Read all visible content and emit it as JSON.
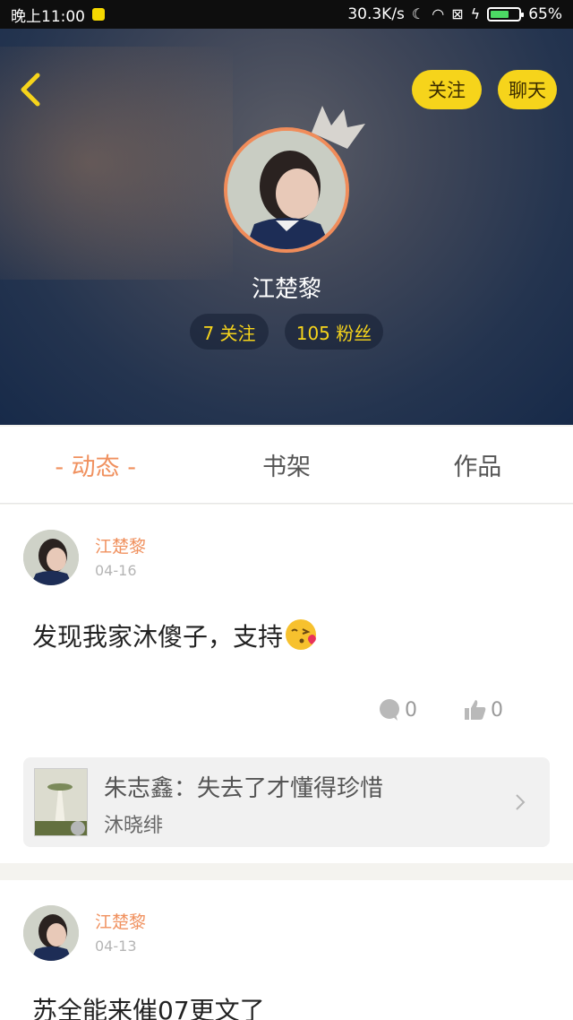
{
  "status_bar": {
    "time": "晚上11:00",
    "network_speed": "30.3K/s",
    "battery_percent": "65%",
    "battery_level": 0.65
  },
  "header": {
    "follow_button": "关注",
    "chat_button": "聊天",
    "user_name": "江楚黎",
    "following_count": "7 关注",
    "fans_count": "105 粉丝"
  },
  "tabs": [
    {
      "label": "- 动态 -",
      "active": true
    },
    {
      "label": "书架",
      "active": false
    },
    {
      "label": "作品",
      "active": false
    }
  ],
  "posts": [
    {
      "author": "江楚黎",
      "date": "04-16",
      "text": "发现我家沐傻子，支持",
      "comment_count": "0",
      "like_count": "0",
      "book": {
        "title": "朱志鑫：失去了才懂得珍惜",
        "author": "沐晓绯"
      }
    },
    {
      "author": "江楚黎",
      "date": "04-13",
      "text": "苏全能来催07更文了"
    }
  ],
  "colors": {
    "accent": "#f0915f",
    "button_yellow": "#f6d41b"
  },
  "icons": [
    "back-arrow-icon",
    "crown-icon",
    "comment-icon",
    "thumbs-up-icon",
    "chevron-right-icon",
    "kiss-emoji-icon"
  ]
}
